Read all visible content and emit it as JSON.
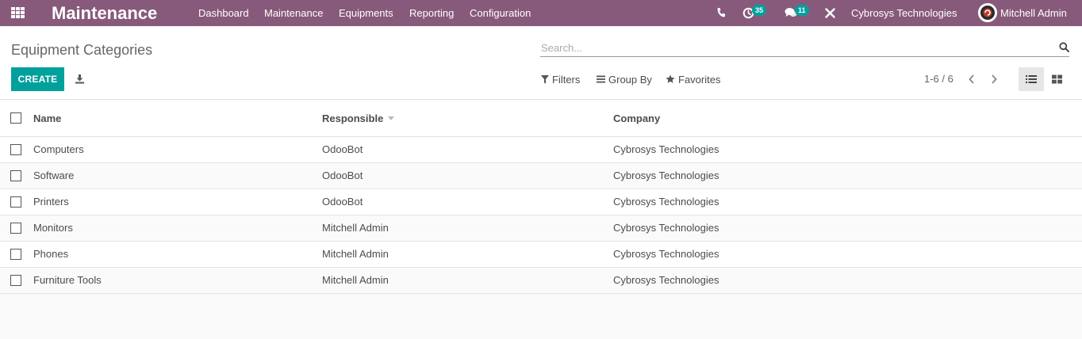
{
  "navbar": {
    "app_name": "Maintenance",
    "menu": [
      "Dashboard",
      "Maintenance",
      "Equipments",
      "Reporting",
      "Configuration"
    ],
    "activity_count": "35",
    "message_count": "11",
    "company": "Cybrosys Technologies",
    "user": "Mitchell Admin",
    "color": "#875a7b"
  },
  "control": {
    "title": "Equipment Categories",
    "search_placeholder": "Search...",
    "create_label": "CREATE",
    "filters_label": "Filters",
    "group_by_label": "Group By",
    "favorites_label": "Favorites",
    "pager": "1-6 / 6",
    "accent_color": "#00a09d"
  },
  "table": {
    "columns": [
      "Name",
      "Responsible",
      "Company"
    ],
    "rows": [
      {
        "name": "Computers",
        "responsible": "OdooBot",
        "company": "Cybrosys Technologies"
      },
      {
        "name": "Software",
        "responsible": "OdooBot",
        "company": "Cybrosys Technologies"
      },
      {
        "name": "Printers",
        "responsible": "OdooBot",
        "company": "Cybrosys Technologies"
      },
      {
        "name": "Monitors",
        "responsible": "Mitchell Admin",
        "company": "Cybrosys Technologies"
      },
      {
        "name": "Phones",
        "responsible": "Mitchell Admin",
        "company": "Cybrosys Technologies"
      },
      {
        "name": "Furniture Tools",
        "responsible": "Mitchell Admin",
        "company": "Cybrosys Technologies"
      }
    ]
  }
}
